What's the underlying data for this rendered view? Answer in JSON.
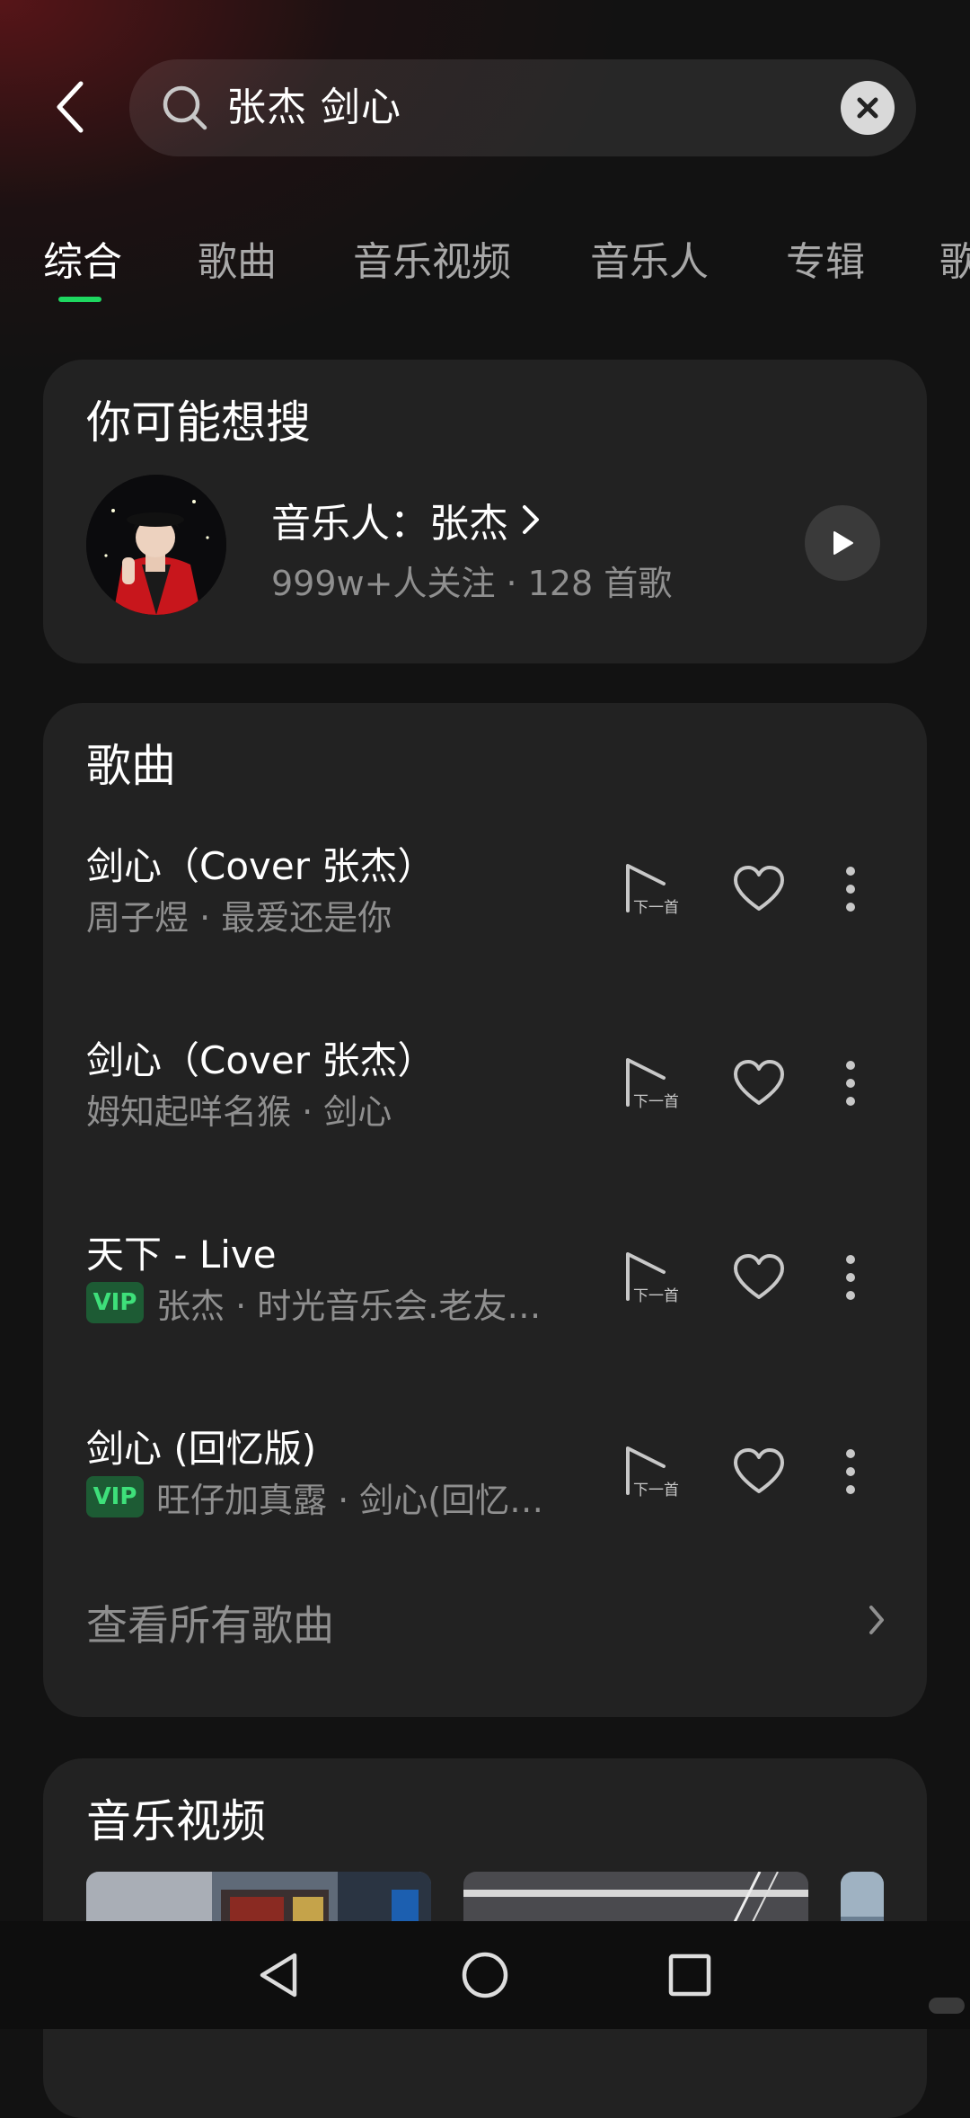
{
  "search": {
    "query": "张杰 剑心"
  },
  "tabs": [
    {
      "label": "综合"
    },
    {
      "label": "歌曲"
    },
    {
      "label": "音乐视频"
    },
    {
      "label": "音乐人"
    },
    {
      "label": "专辑"
    },
    {
      "label": "歌"
    }
  ],
  "suggest": {
    "title": "你可能想搜",
    "artist_label": "音乐人：张杰",
    "meta": "999w+人关注 · 128 首歌"
  },
  "songs": {
    "title": "歌曲",
    "next_label": "下一首",
    "items": [
      {
        "title": "剑心（Cover 张杰）",
        "subtitle": "周子煜 · 最爱还是你",
        "vip": false
      },
      {
        "title": "剑心（Cover 张杰）",
        "subtitle": "姆知起咩名猴 · 剑心",
        "vip": false
      },
      {
        "title": "天下 - Live",
        "subtitle": "张杰 · 时光音乐会.老友…",
        "vip": true
      },
      {
        "title": "剑心 (回忆版)",
        "subtitle": "旺仔加真露 · 剑心(回忆…",
        "vip": true
      }
    ],
    "vip_label": "VIP",
    "see_all": "查看所有歌曲"
  },
  "mv": {
    "title": "音乐视频"
  },
  "colors": {
    "accent": "#1ed760",
    "background": "#121212",
    "card": "#222222",
    "vip_bg": "#1d5b34",
    "vip_text": "#3ee07a"
  }
}
